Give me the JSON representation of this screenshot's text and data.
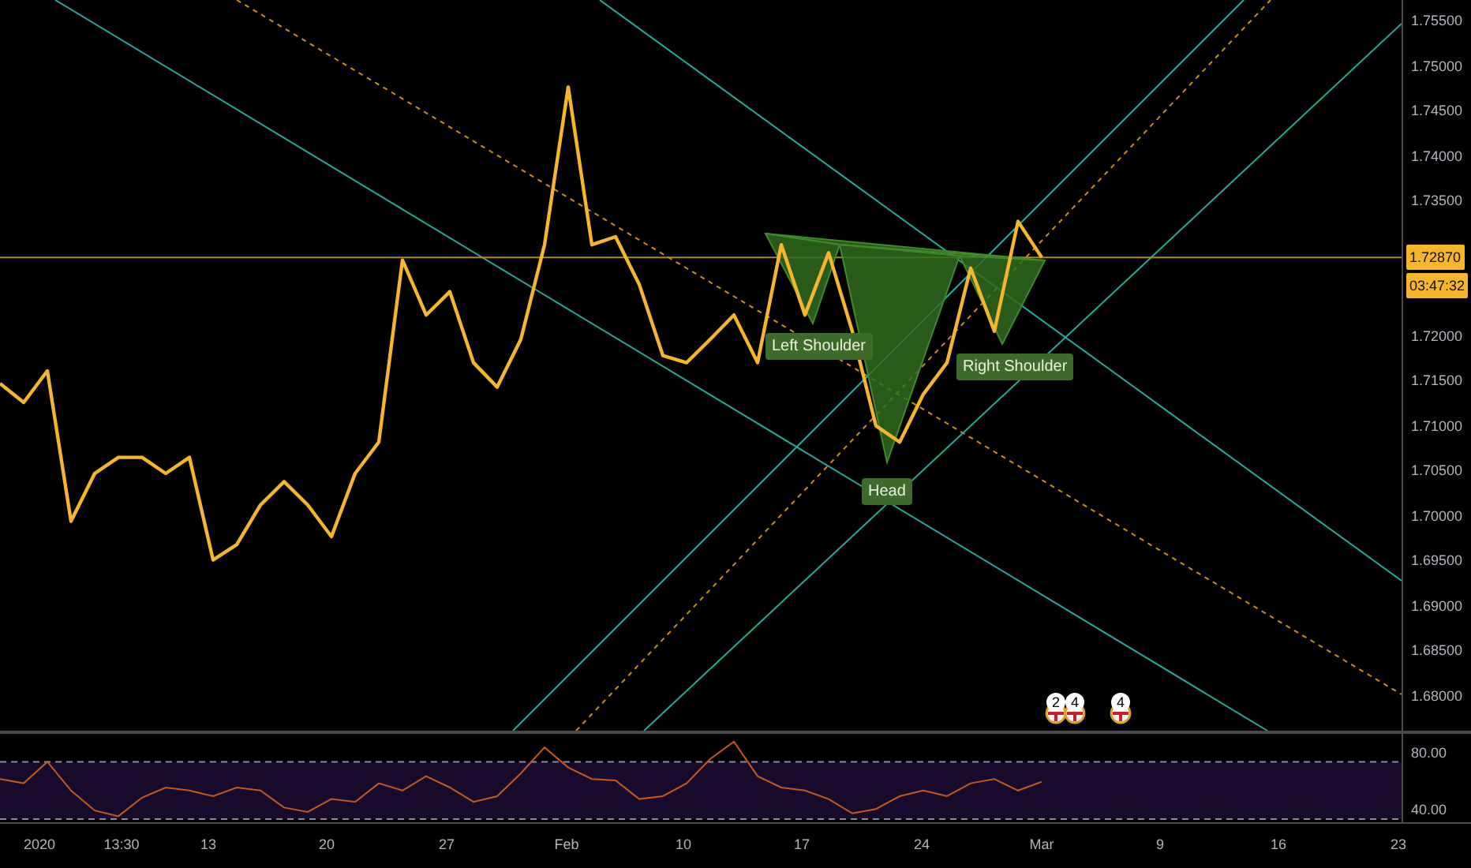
{
  "price_pane": {
    "chart_data": {
      "type": "line",
      "series": [
        {
          "color": "#f7b52c",
          "values": [
            1.7147,
            1.7126,
            1.7161,
            1.6994,
            1.7047,
            1.7065,
            1.7065,
            1.7047,
            1.7065,
            1.6951,
            1.6968,
            1.7012,
            1.7038,
            1.7012,
            1.6977,
            1.7047,
            1.7082,
            1.7284,
            1.7223,
            1.7249,
            1.717,
            1.7143,
            1.7196,
            1.7301,
            1.7476,
            1.7301,
            1.731,
            1.7257,
            1.7178,
            1.717,
            1.7196,
            1.7223,
            1.717,
            1.7301,
            1.7223,
            1.7292,
            1.7205,
            1.71,
            1.7082,
            1.7135,
            1.717,
            1.7275,
            1.7205,
            1.7327,
            1.7287
          ]
        }
      ],
      "ylim": [
        1.67614,
        1.75728
      ],
      "yticks": [
        {
          "value": 1.755,
          "label": "1.75500"
        },
        {
          "value": 1.75,
          "label": "1.75000"
        },
        {
          "value": 1.745,
          "label": "1.74500"
        },
        {
          "value": 1.74,
          "label": "1.74000"
        },
        {
          "value": 1.735,
          "label": "1.73500"
        },
        {
          "value": 1.72,
          "label": "1.72000"
        },
        {
          "value": 1.715,
          "label": "1.71500"
        },
        {
          "value": 1.71,
          "label": "1.71000"
        },
        {
          "value": 1.705,
          "label": "1.70500"
        },
        {
          "value": 1.7,
          "label": "1.70000"
        },
        {
          "value": 1.695,
          "label": "1.69500"
        },
        {
          "value": 1.69,
          "label": "1.69000"
        },
        {
          "value": 1.685,
          "label": "1.68500"
        },
        {
          "value": 1.68,
          "label": "1.68000"
        }
      ]
    },
    "pattern_labels": [
      "Left Shoulder",
      "Head",
      "Right Shoulder"
    ],
    "last_price": "1.72870",
    "countdown": "03:47:32",
    "event_markers": [
      {
        "count": "2"
      },
      {
        "count": "4"
      },
      {
        "count": "4"
      }
    ]
  },
  "rsi_pane": {
    "chart_data": {
      "type": "line",
      "series": [
        {
          "color": "#c8581a",
          "values": [
            68,
            65,
            80,
            60,
            46,
            42,
            55,
            62,
            60,
            56,
            62,
            60,
            48,
            45,
            54,
            52,
            65,
            60,
            70,
            62,
            52,
            56,
            72,
            90,
            76,
            68,
            67,
            54,
            56,
            65,
            82,
            94,
            70,
            62,
            60,
            54,
            44,
            47,
            56,
            60,
            56,
            65,
            68,
            60,
            66
          ]
        }
      ],
      "ylim": [
        37.8,
        99.5
      ],
      "yticks": [
        {
          "value": 80,
          "label": "80.00"
        },
        {
          "value": 40,
          "label": "40.00"
        }
      ]
    }
  },
  "time_axis": [
    "2020",
    "13:30",
    "13",
    "20",
    "27",
    "Feb",
    "10",
    "17",
    "24",
    "Mar",
    "9",
    "16",
    "23"
  ]
}
